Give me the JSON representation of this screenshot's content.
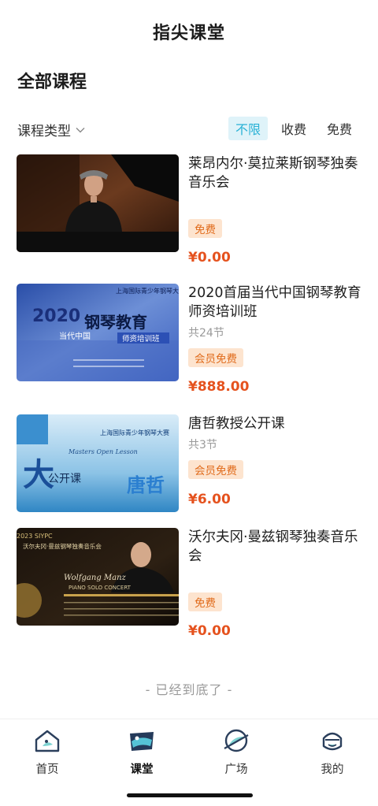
{
  "header": {
    "title": "指尖课堂"
  },
  "section": {
    "title": "全部课程"
  },
  "filter": {
    "type_label": "课程类型",
    "options": [
      "不限",
      "收费",
      "免费"
    ],
    "selected": "不限"
  },
  "courses": [
    {
      "title": "莱昂内尔·莫拉莱斯钢琴独奏音乐会",
      "lessons": "",
      "badge": "免费",
      "price": "¥0.00",
      "thumb_text": []
    },
    {
      "title": "2020首届当代中国钢琴教育师资培训班",
      "lessons": "共24节",
      "badge": "会员免费",
      "price": "¥888.00",
      "thumb_text": [
        "上海国际青少年钢琴大赛",
        "2020",
        "钢琴教育",
        "当代中国",
        "师资培训班"
      ]
    },
    {
      "title": "唐哲教授公开课",
      "lessons": "共3节",
      "badge": "会员免费",
      "price": "¥6.00",
      "thumb_text": [
        "上海国际青少年钢琴大赛",
        "Masters Open Lesson",
        "公开课",
        "唐哲"
      ]
    },
    {
      "title": "沃尔夫冈·曼兹钢琴独奏音乐会",
      "lessons": "",
      "badge": "免费",
      "price": "¥0.00",
      "thumb_text": [
        "2023 SIYPC",
        "沃尔夫冈·曼兹钢琴独奏音乐会",
        "Wolfgang Manz",
        "PIANO SOLO CONCERT"
      ]
    }
  ],
  "footer": {
    "end_text": "- 已经到底了 -"
  },
  "nav": [
    {
      "label": "首页",
      "icon": "home-icon"
    },
    {
      "label": "课堂",
      "icon": "classroom-icon",
      "active": true
    },
    {
      "label": "广场",
      "icon": "plaza-icon"
    },
    {
      "label": "我的",
      "icon": "profile-icon"
    }
  ],
  "colors": {
    "accent": "#2ab2d6",
    "price": "#e5521e",
    "badge_bg": "#fde4cf",
    "badge_text": "#e06a1a"
  }
}
